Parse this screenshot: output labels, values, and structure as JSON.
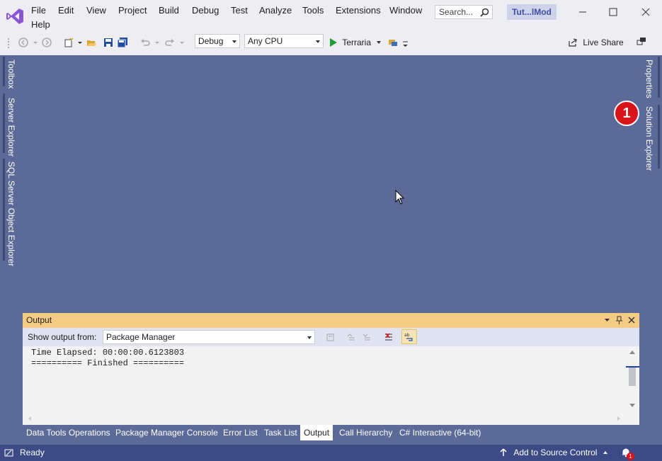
{
  "menu": {
    "items": [
      {
        "label": "File"
      },
      {
        "label": "Edit"
      },
      {
        "label": "View"
      },
      {
        "label": "Project"
      },
      {
        "label": "Build"
      },
      {
        "label": "Debug"
      },
      {
        "label": "Test"
      },
      {
        "label": "Analyze"
      },
      {
        "label": "Tools"
      },
      {
        "label": "Extensions"
      },
      {
        "label": "Window"
      },
      {
        "label": "Help"
      }
    ]
  },
  "search": {
    "placeholder": "Search..."
  },
  "solution_name": "Tut...lMod",
  "toolbar": {
    "configuration": "Debug",
    "platform": "Any CPU",
    "run_target": "Terraria",
    "live_share": "Live Share"
  },
  "side_tabs": {
    "left": [
      "Toolbox",
      "Server Explorer",
      "SQL Server Object Explorer"
    ],
    "right": [
      "Properties",
      "Solution Explorer"
    ]
  },
  "annotation": "1",
  "output": {
    "title": "Output",
    "source_label": "Show output from:",
    "source_value": "Package Manager",
    "lines": [
      "Time Elapsed: 00:00:00.6123803",
      "========== Finished =========="
    ]
  },
  "bottom_tabs": [
    {
      "label": "Data Tools Operations"
    },
    {
      "label": "Package Manager Console"
    },
    {
      "label": "Error List"
    },
    {
      "label": "Task List"
    },
    {
      "label": "Output"
    },
    {
      "label": "Call Hierarchy"
    },
    {
      "label": "C# Interactive (64-bit)"
    }
  ],
  "status": {
    "text": "Ready",
    "source_control": "Add to Source Control",
    "notification_count": "1"
  },
  "colors": {
    "accent": "#5c6a97",
    "status_bar": "#3c4a86",
    "output_header": "#f5cc84",
    "annotation": "#d9141b"
  }
}
